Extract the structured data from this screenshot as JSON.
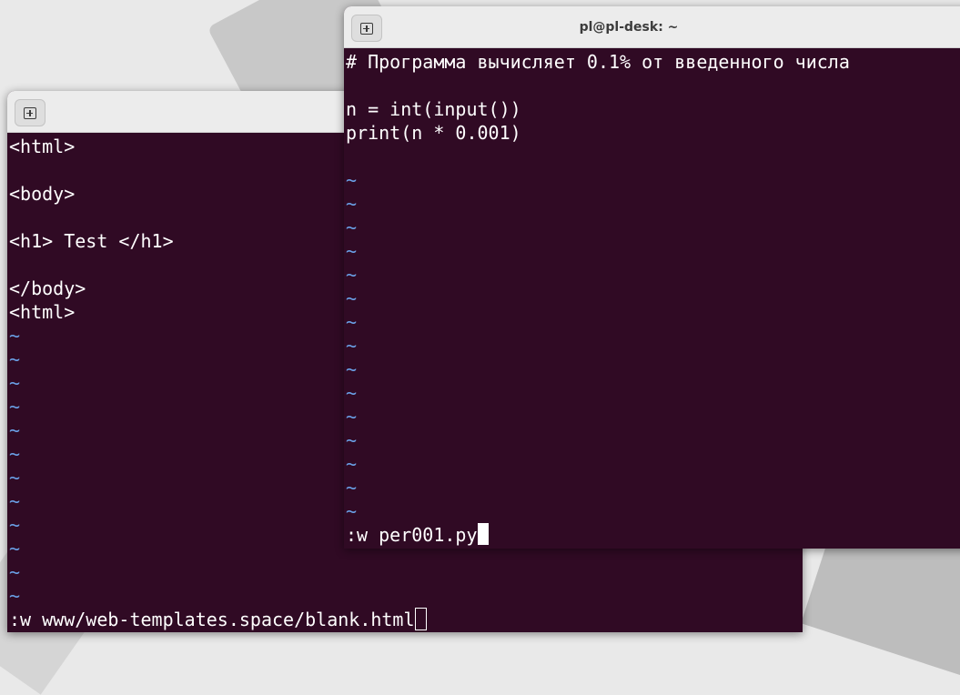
{
  "windows": {
    "left": {
      "title": "",
      "lines": [
        "<html>",
        "",
        "<body>",
        "",
        "<h1> Test </h1>",
        "",
        "</body>",
        "<html>"
      ],
      "tilde_count": 12,
      "command": ":w www/web-templates.space/blank.html"
    },
    "right": {
      "title": "pl@pl-desk: ~",
      "lines": [
        "# Программа вычисляет 0.1% от введенного числа",
        "",
        "n = int(input())",
        "print(n * 0.001)",
        ""
      ],
      "tilde_count": 15,
      "command": ":w per001.py"
    }
  },
  "colors": {
    "terminal_bg": "#300a24",
    "text": "#ffffff",
    "tilde": "#6aa0e6",
    "titlebar": "#ececec"
  },
  "icons": {
    "new_tab": "new-tab-icon"
  }
}
